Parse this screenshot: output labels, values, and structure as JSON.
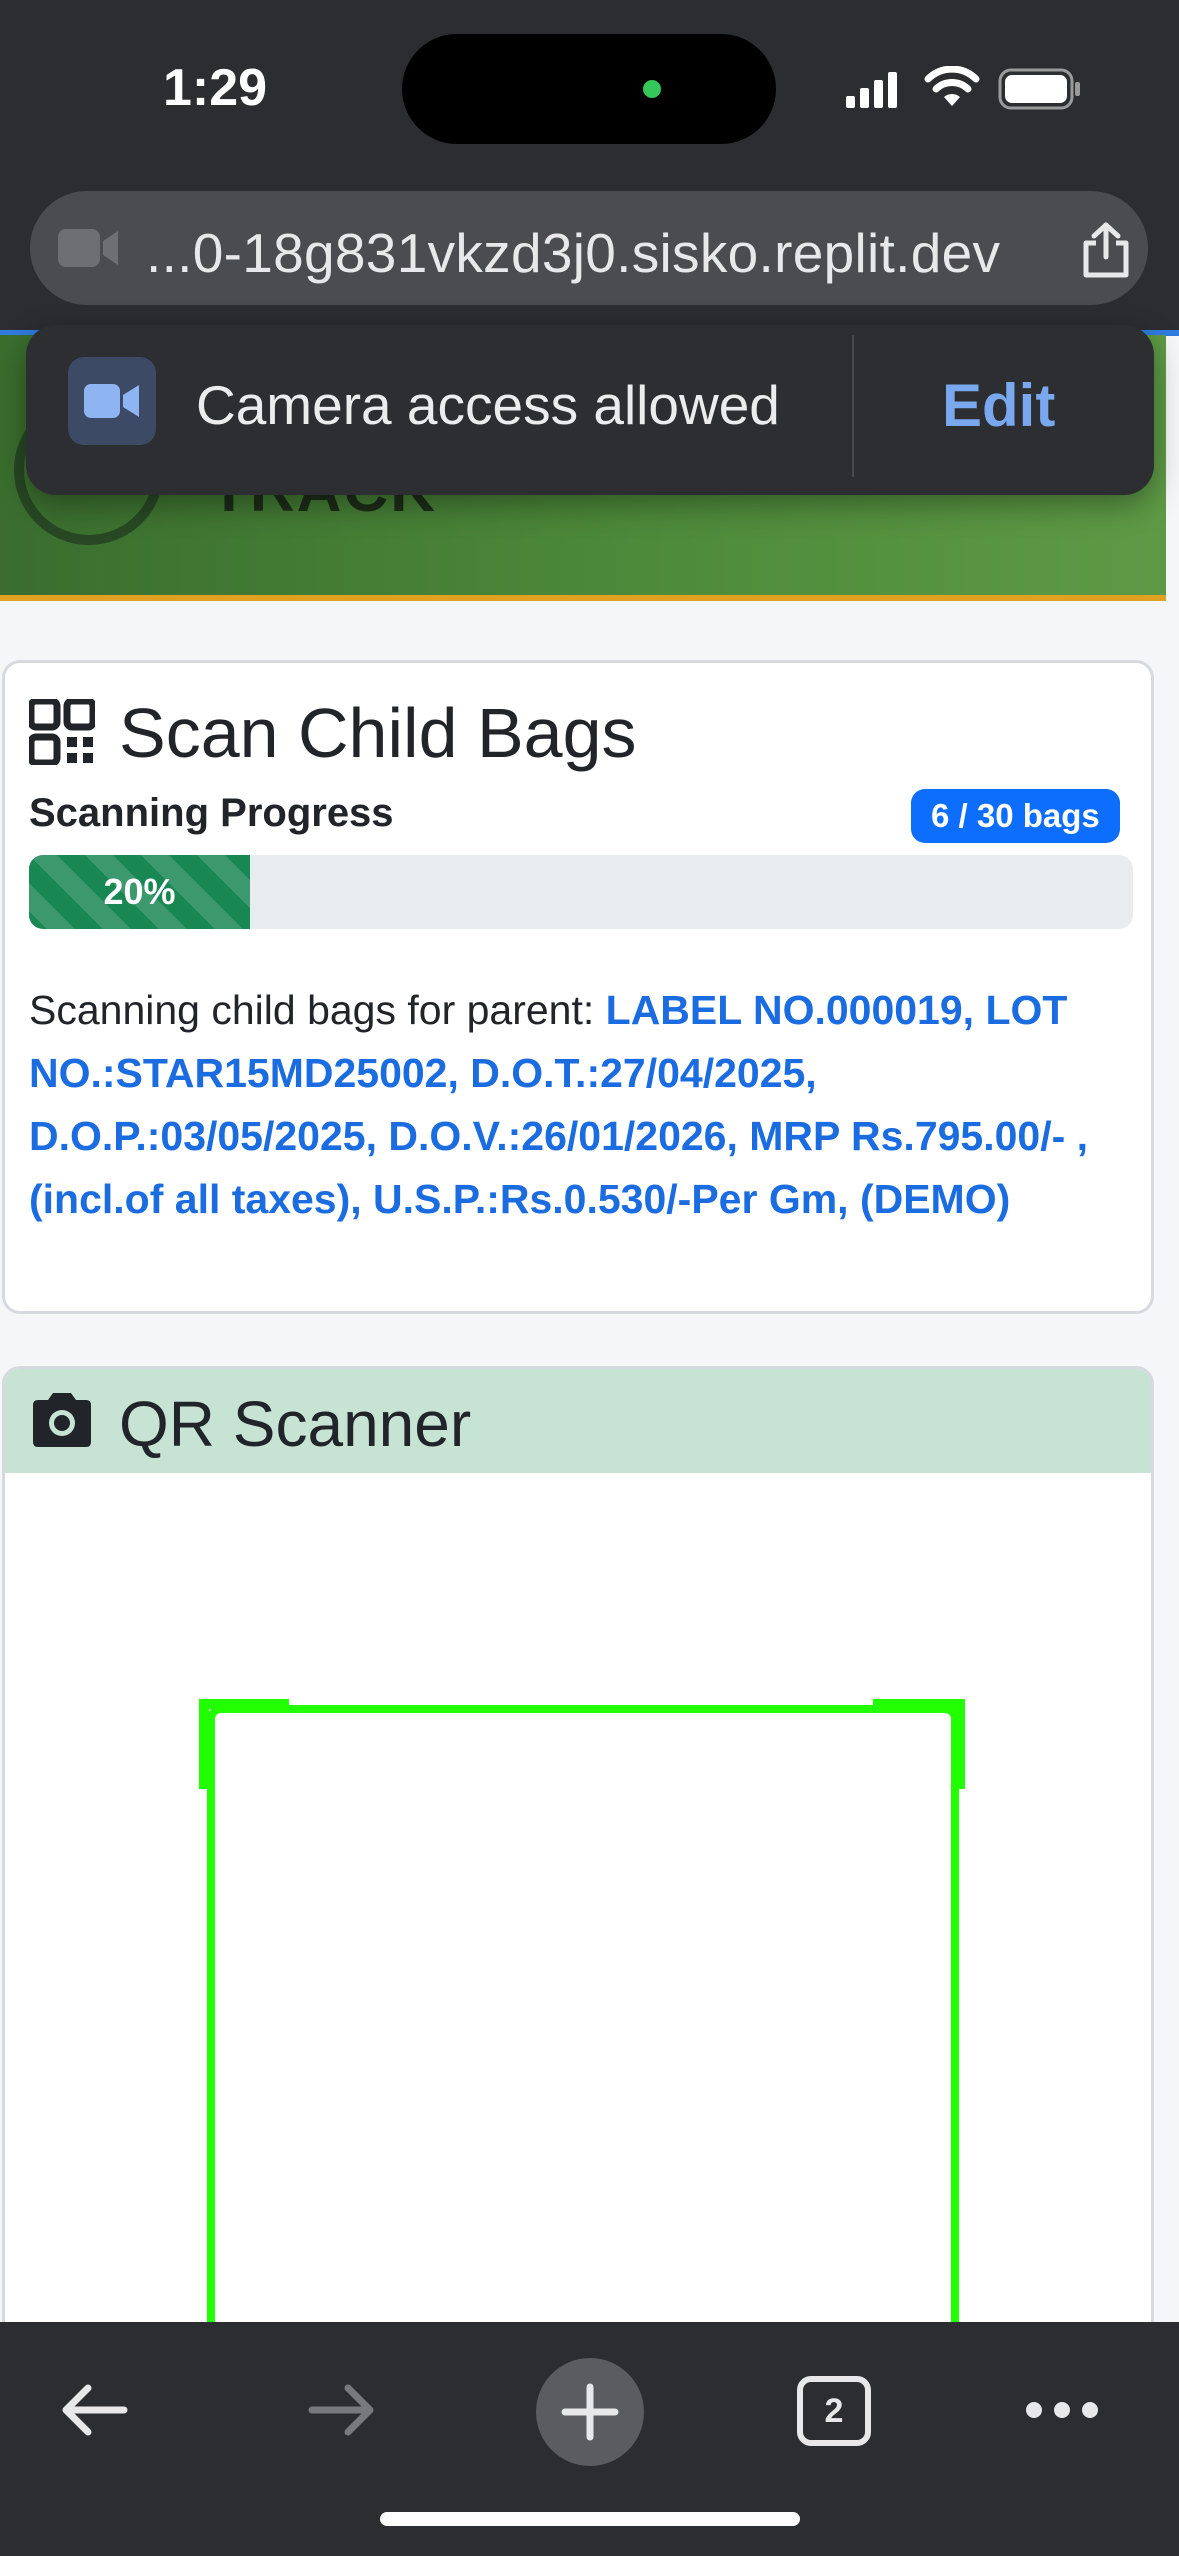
{
  "status_bar": {
    "time": "1:29"
  },
  "browser": {
    "url": "...0-18g831vkzd3j0.sisko.replit.dev",
    "tab_count": "2"
  },
  "header": {
    "brand_partial": "TRACK"
  },
  "permission_banner": {
    "message": "Camera access allowed",
    "edit_label": "Edit"
  },
  "scan_card": {
    "title": "Scan Child Bags",
    "progress_label": "Scanning Progress",
    "badge": "6 / 30 bags",
    "progress_fraction": 0.2,
    "progress_text": "20%",
    "parent_prefix": "Scanning child bags for parent: ",
    "parent_label": "LABEL NO.000019, LOT NO.:STAR15MD25002, D.O.T.:27/04/2025, D.O.P.:03/05/2025, D.O.V.:26/01/2026, MRP Rs.795.00/- , (incl.of all taxes), U.S.P.:Rs.0.530/-Per Gm, (DEMO)"
  },
  "scanner": {
    "title": "QR Scanner"
  },
  "colors": {
    "accent_blue": "#0d6efd",
    "progress_green": "#198754",
    "scanner_frame": "#22ff00",
    "scanner_header": "#c6e3d4"
  }
}
